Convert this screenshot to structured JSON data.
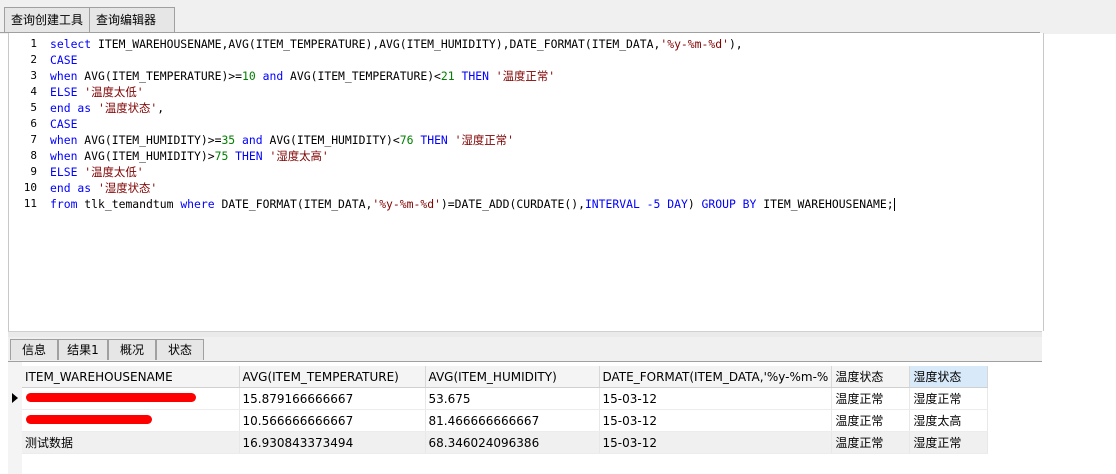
{
  "top_tabs": [
    {
      "label": "查询创建工具",
      "active": false
    },
    {
      "label": "查询编辑器",
      "active": true
    }
  ],
  "editor": {
    "line_numbers": [
      "1",
      "2",
      "3",
      "4",
      "5",
      "6",
      "7",
      "8",
      "9",
      "10",
      "11"
    ],
    "lines": [
      [
        {
          "t": "select ",
          "c": "kw"
        },
        {
          "t": "ITEM_WAREHOUSENAME,AVG(ITEM_TEMPERATURE),AVG(ITEM_HUMIDITY),DATE_FORMAT(ITEM_DATA,",
          "c": ""
        },
        {
          "t": "'%y-%m-%d'",
          "c": "str"
        },
        {
          "t": "),",
          "c": ""
        }
      ],
      [
        {
          "t": "CASE",
          "c": "kw"
        }
      ],
      [
        {
          "t": "when ",
          "c": "kw"
        },
        {
          "t": "AVG(ITEM_TEMPERATURE)>=",
          "c": ""
        },
        {
          "t": "10",
          "c": "num"
        },
        {
          "t": " and ",
          "c": "kw"
        },
        {
          "t": "AVG(ITEM_TEMPERATURE)<",
          "c": ""
        },
        {
          "t": "21",
          "c": "num"
        },
        {
          "t": " THEN ",
          "c": "kw"
        },
        {
          "t": "'温度正常'",
          "c": "str"
        }
      ],
      [
        {
          "t": "ELSE ",
          "c": "kw"
        },
        {
          "t": "'温度太低'",
          "c": "str"
        }
      ],
      [
        {
          "t": "end as ",
          "c": "kw"
        },
        {
          "t": "'温度状态'",
          "c": "str"
        },
        {
          "t": ",",
          "c": ""
        }
      ],
      [
        {
          "t": "CASE",
          "c": "kw"
        }
      ],
      [
        {
          "t": "when ",
          "c": "kw"
        },
        {
          "t": "AVG(ITEM_HUMIDITY)>=",
          "c": ""
        },
        {
          "t": "35",
          "c": "num"
        },
        {
          "t": " and ",
          "c": "kw"
        },
        {
          "t": "AVG(ITEM_HUMIDITY)<",
          "c": ""
        },
        {
          "t": "76",
          "c": "num"
        },
        {
          "t": " THEN ",
          "c": "kw"
        },
        {
          "t": "'湿度正常'",
          "c": "str"
        }
      ],
      [
        {
          "t": "when ",
          "c": "kw"
        },
        {
          "t": "AVG(ITEM_HUMIDITY)>",
          "c": ""
        },
        {
          "t": "75",
          "c": "num"
        },
        {
          "t": " THEN ",
          "c": "kw"
        },
        {
          "t": "'湿度太高'",
          "c": "str"
        }
      ],
      [
        {
          "t": "ELSE ",
          "c": "kw"
        },
        {
          "t": "'温度太低'",
          "c": "str"
        }
      ],
      [
        {
          "t": "end as ",
          "c": "kw"
        },
        {
          "t": "'湿度状态'",
          "c": "str"
        }
      ],
      [
        {
          "t": "from ",
          "c": "kw"
        },
        {
          "t": "tlk_temandtum ",
          "c": ""
        },
        {
          "t": "where ",
          "c": "kw"
        },
        {
          "t": "DATE_FORMAT(ITEM_DATA,",
          "c": ""
        },
        {
          "t": "'%y-%m-%d'",
          "c": "str"
        },
        {
          "t": ")=DATE_ADD(CURDATE(),",
          "c": ""
        },
        {
          "t": "INTERVAL -5 DAY",
          "c": "kw"
        },
        {
          "t": ") ",
          "c": ""
        },
        {
          "t": "GROUP BY ",
          "c": "kw"
        },
        {
          "t": "ITEM_WAREHOUSENAME;",
          "c": ""
        }
      ]
    ]
  },
  "result_tabs": [
    {
      "label": "信息",
      "active": false
    },
    {
      "label": "结果1",
      "active": true
    },
    {
      "label": "概况",
      "active": false
    },
    {
      "label": "状态",
      "active": false
    }
  ],
  "results": {
    "columns": [
      "ITEM_WAREHOUSENAME",
      "AVG(ITEM_TEMPERATURE)",
      "AVG(ITEM_HUMIDITY)",
      "DATE_FORMAT(ITEM_DATA,'%y-%m-%",
      "温度状态",
      "湿度状态"
    ],
    "rows": [
      [
        "",
        "15.879166666667",
        "53.675",
        "15-03-12",
        "温度正常",
        "湿度正常"
      ],
      [
        "",
        "10.566666666667",
        "81.466666666667",
        "15-03-12",
        "温度正常",
        "湿度太高"
      ],
      [
        "测试数据",
        "16.930843373494",
        "68.346024096386",
        "15-03-12",
        "温度正常",
        "湿度正常"
      ]
    ]
  }
}
